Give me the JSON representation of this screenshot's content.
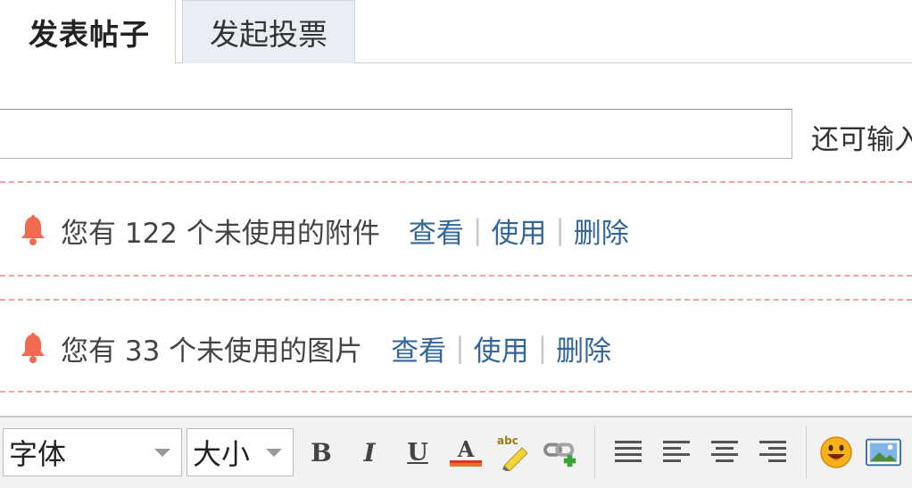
{
  "tabs": [
    {
      "label": "发表帖子",
      "active": true
    },
    {
      "label": "发起投票",
      "active": false
    }
  ],
  "subject": {
    "value": "",
    "placeholder": "",
    "remain_label": "还可输入"
  },
  "notices": [
    {
      "message": "您有 122 个未使用的附件",
      "view": "查看",
      "use": "使用",
      "delete": "删除"
    },
    {
      "message": "您有 33 个未使用的图片",
      "view": "查看",
      "use": "使用",
      "delete": "删除"
    }
  ],
  "toolbar": {
    "font_select": "字体",
    "size_select": "大小",
    "icons": [
      "bold-icon",
      "italic-icon",
      "underline-icon",
      "font-color-icon",
      "highlight-icon",
      "link-icon",
      "align-justify-icon",
      "align-left-icon",
      "align-center-icon",
      "align-right-icon",
      "smiley-icon",
      "image-icon"
    ],
    "bold_glyph": "B",
    "italic_glyph": "I",
    "underline_glyph": "U",
    "color_glyph": "A",
    "highlight_glyph": "abc"
  },
  "colors": {
    "link": "#336699",
    "bell": "#f26a4f",
    "dashed_border": "#f0a5a0",
    "inactive_tab": "#e9eef4",
    "toolbar_bg": "#f2f2f2"
  }
}
